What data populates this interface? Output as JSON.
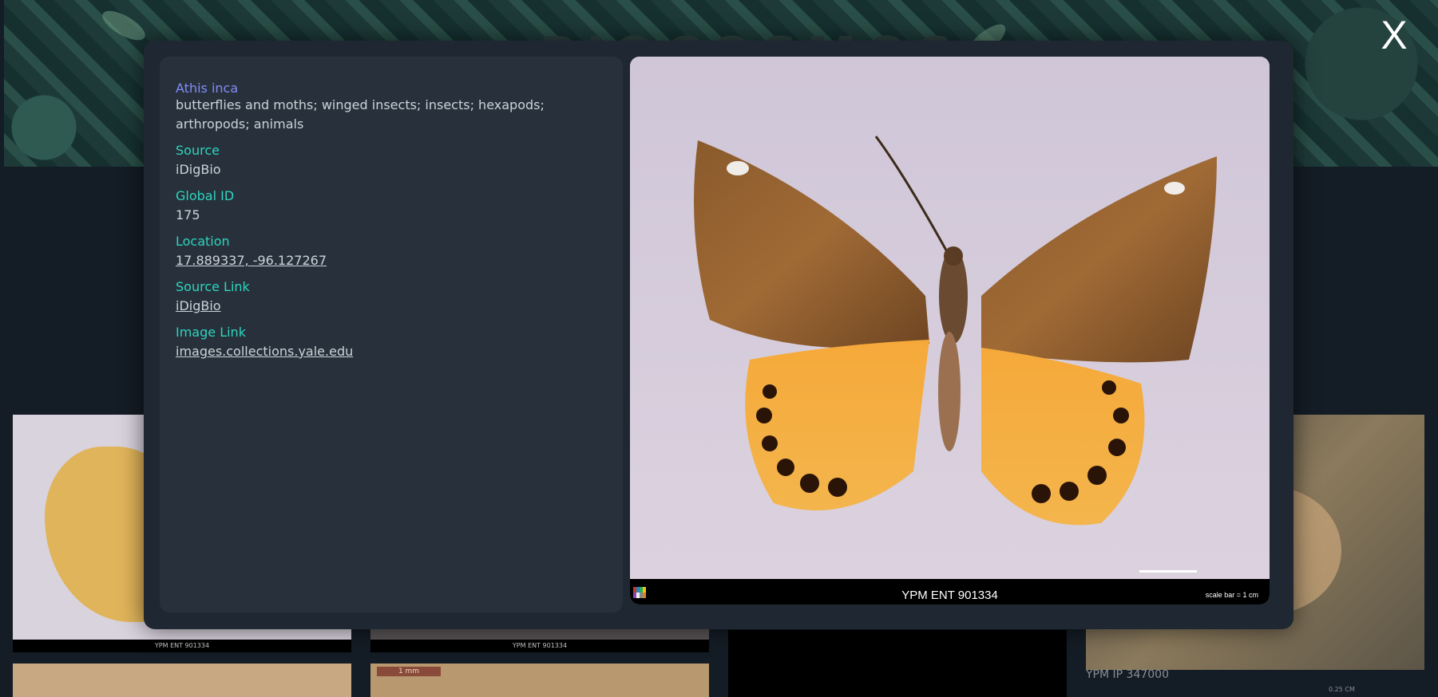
{
  "background": {
    "banner_title": "BIOCOSMOS",
    "cards": [
      {
        "caption": "YPM ENT 901334"
      },
      {
        "caption": "YPM ENT 901334"
      },
      {
        "caption": "1 mm"
      },
      {
        "caption": "YPM IP 347000"
      },
      {
        "caption": "0.25 CM"
      }
    ]
  },
  "close_label": "X",
  "specimen": {
    "name": "Athis inca",
    "taxonomy": "butterflies and moths; winged insects; insects; hexapods; arthropods; animals",
    "fields": {
      "source_label": "Source",
      "source_value": "iDigBio",
      "global_id_label": "Global ID",
      "global_id_value": "175",
      "location_label": "Location",
      "location_value": "17.889337, -96.127267",
      "source_link_label": "Source Link",
      "source_link_value": "iDigBio",
      "image_link_label": "Image Link",
      "image_link_value": "images.collections.yale.edu"
    },
    "image": {
      "catalog_code": "YPM ENT 901334",
      "scale_text": "scale bar = 1 cm"
    }
  },
  "colors": {
    "title": "#818cf8",
    "label": "#2dd4bf",
    "text": "#cbd2d9",
    "panel": "#28313b",
    "modal": "#1e2732"
  }
}
